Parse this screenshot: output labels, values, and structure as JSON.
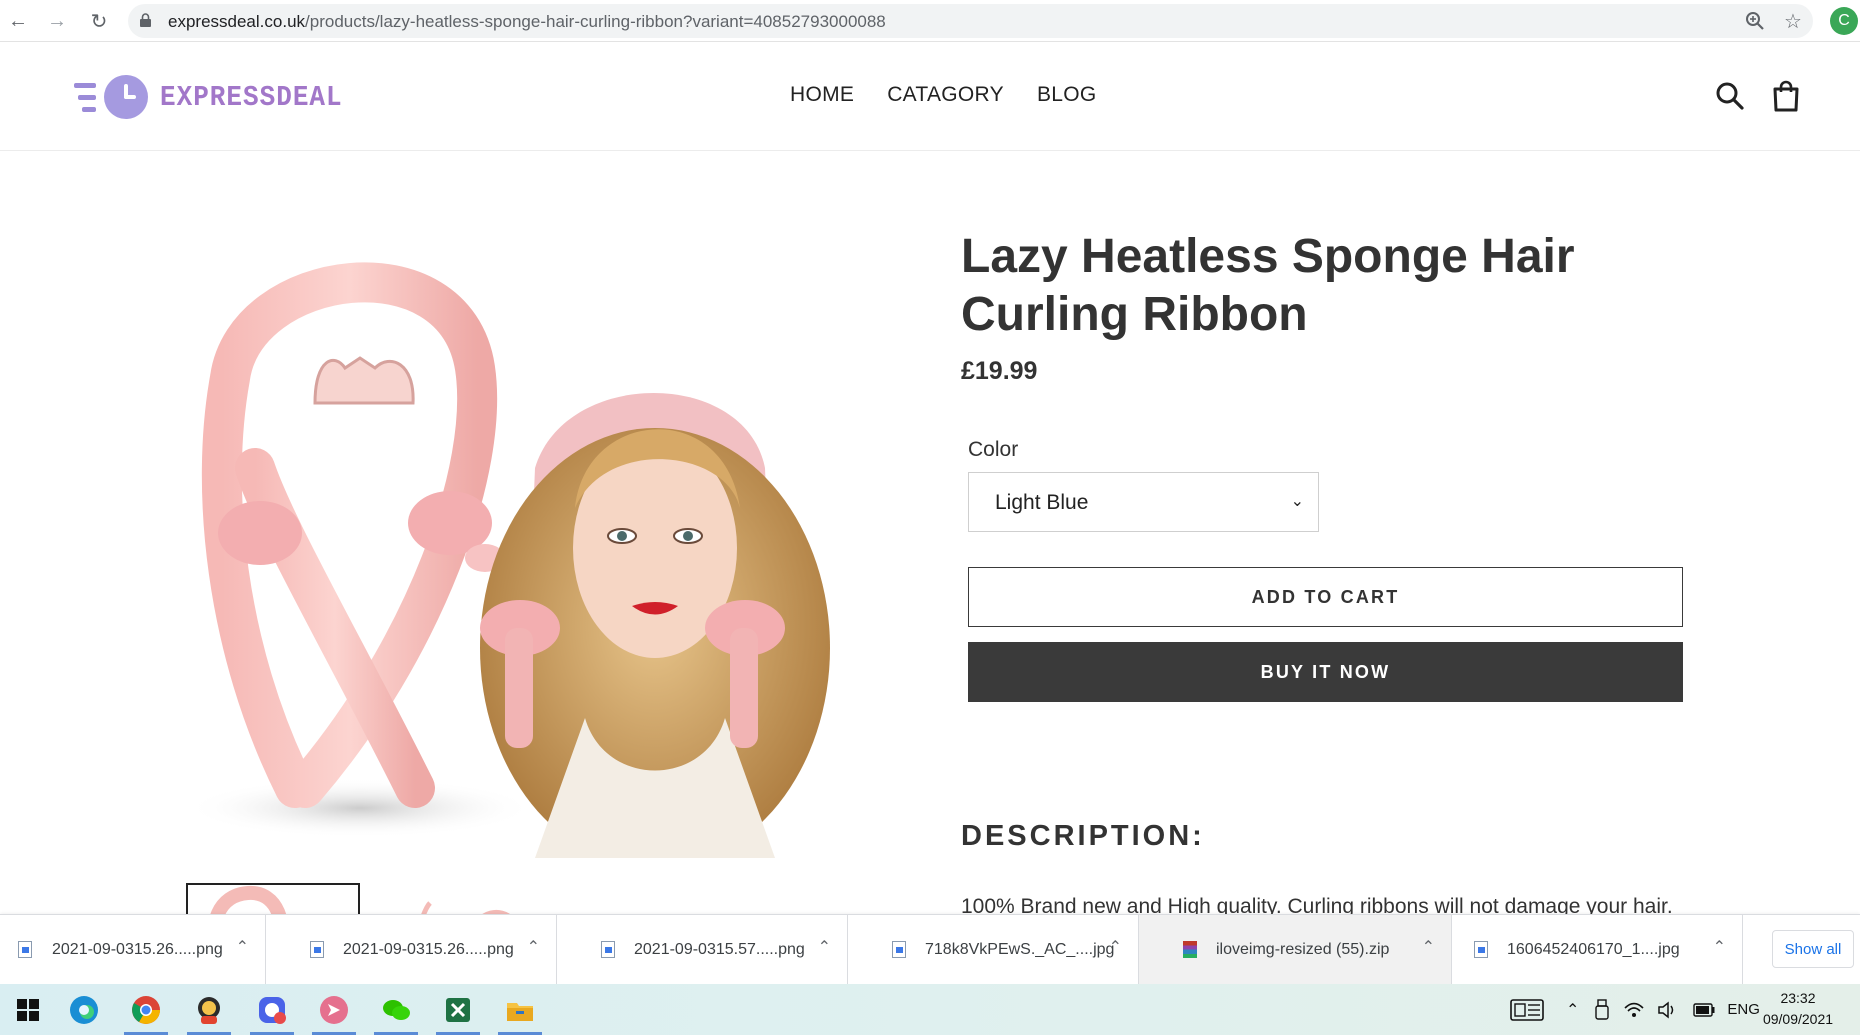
{
  "browser": {
    "url_host": "expressdeal.co.uk",
    "url_path": "/products/lazy-heatless-sponge-hair-curling-ribbon?variant=40852793000088",
    "profile_initial": "C",
    "icons": [
      "back-icon",
      "forward-icon",
      "reload-icon",
      "lock-icon",
      "zoom-icon",
      "star-icon"
    ]
  },
  "site": {
    "logo_text": "EXPRESSDEAL",
    "nav": [
      "HOME",
      "CATAGORY",
      "BLOG"
    ],
    "icons": [
      "search-icon",
      "cart-icon"
    ],
    "brand_color": "#a277c9"
  },
  "product": {
    "title": "Lazy Heatless Sponge Hair Curling Ribbon",
    "price": "£19.99",
    "color_label": "Color",
    "color_selected": "Light Blue",
    "add_to_cart": "ADD TO CART",
    "buy_now": "BUY IT NOW",
    "description_heading": "DESCRIPTION:",
    "description_text": "100% Brand new and High quality. Curling ribbons will not damage your hair."
  },
  "downloads": {
    "items": [
      {
        "name": "2021-09-0315.26.....png",
        "type": "png"
      },
      {
        "name": "2021-09-0315.26.....png",
        "type": "png"
      },
      {
        "name": "2021-09-0315.57.....png",
        "type": "png"
      },
      {
        "name": "718k8VkPEwS._AC_....jpg",
        "type": "jpg"
      },
      {
        "name": "iloveimg-resized (55).zip",
        "type": "zip"
      },
      {
        "name": "1606452406170_1....jpg",
        "type": "jpg"
      }
    ],
    "show_all": "Show all"
  },
  "taskbar": {
    "apps": [
      "windows-start-icon",
      "edge-icon",
      "chrome-icon",
      "app-icon-1",
      "app-icon-2",
      "app-icon-3",
      "wechat-icon",
      "excel-icon",
      "file-explorer-icon"
    ],
    "language": "ENG",
    "time": "23:32",
    "date": "09/09/2021"
  }
}
